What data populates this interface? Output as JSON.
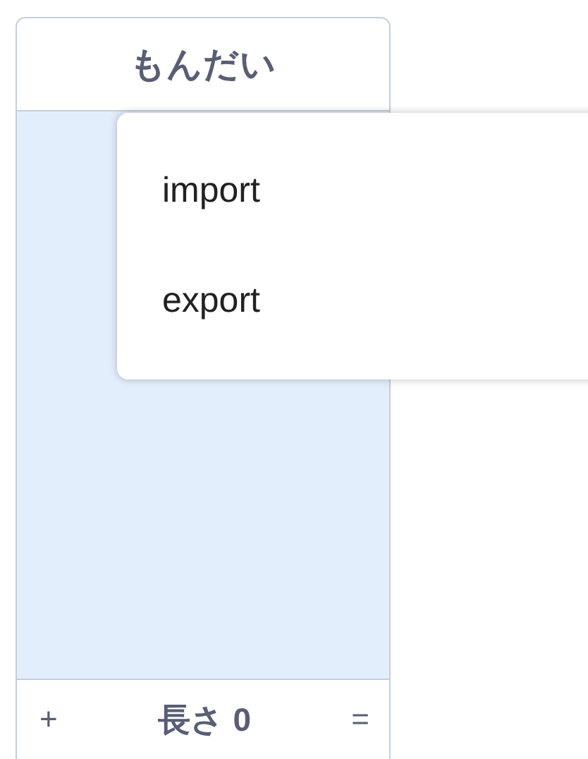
{
  "list_monitor": {
    "title": "もんだい",
    "footer": {
      "add_button": "+",
      "length": "長さ 0",
      "resize_handle": "="
    }
  },
  "context_menu": {
    "items": [
      {
        "label": "import"
      },
      {
        "label": "export"
      }
    ]
  }
}
